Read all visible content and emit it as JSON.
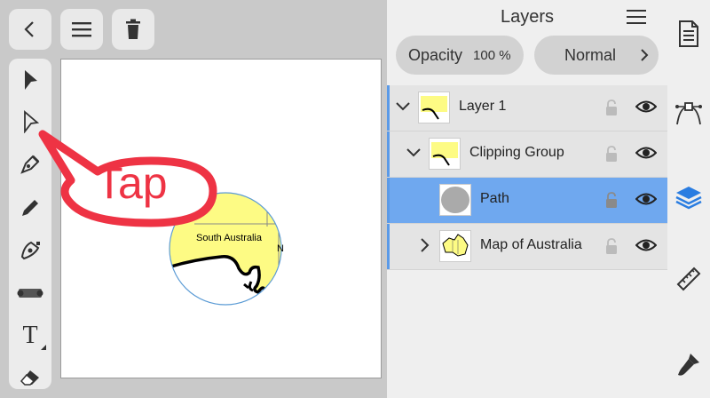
{
  "top_toolbar": {
    "back_icon": "chevron-left-icon",
    "menu_icon": "hamburger-icon",
    "delete_icon": "trash-icon"
  },
  "tools": [
    {
      "name": "select-tool",
      "icon": "arrow-solid-icon"
    },
    {
      "name": "direct-select-tool",
      "icon": "arrow-outline-icon"
    },
    {
      "name": "pen-tool",
      "icon": "pen-nib-icon"
    },
    {
      "name": "pencil-tool",
      "icon": "pencil-icon"
    },
    {
      "name": "shape-builder-tool",
      "icon": "shape-icon"
    },
    {
      "name": "gradient-tool",
      "icon": "gradient-bar-icon"
    },
    {
      "name": "text-tool",
      "icon": "text-icon",
      "label": "T"
    },
    {
      "name": "eraser-tool",
      "icon": "eraser-icon"
    }
  ],
  "canvas": {
    "callout_text": "Tap",
    "map_label": "South Australia",
    "map_label_edge": "N"
  },
  "layers_panel": {
    "title": "Layers",
    "opacity_label": "Opacity",
    "opacity_value": "100 %",
    "blend_mode": "Normal",
    "rows": [
      {
        "label": "Layer 1",
        "expanded": true,
        "selected": false
      },
      {
        "label": "Clipping Group",
        "expanded": true,
        "selected": false
      },
      {
        "label": "Path",
        "selected": true
      },
      {
        "label": "Map of Australia",
        "expanded": false,
        "selected": false
      }
    ]
  },
  "right_sidebar": [
    {
      "name": "document-icon"
    },
    {
      "name": "path-edit-icon"
    },
    {
      "name": "layers-icon"
    },
    {
      "name": "ruler-icon"
    },
    {
      "name": "brush-icon"
    }
  ],
  "colors": {
    "selected_row": "#6fa8ef",
    "callout": "#ee3344",
    "map_yellow": "#fdfb84"
  }
}
